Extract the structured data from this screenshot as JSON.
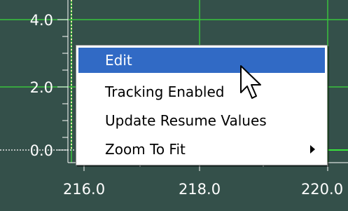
{
  "plot": {
    "x_ticks": [
      "216.0",
      "218.0",
      "220.0"
    ],
    "y_ticks": [
      "4.0",
      "2.0",
      "0.0"
    ],
    "colors": {
      "background": "#34504a",
      "grid": "#39c23c",
      "trace": "#39e33c",
      "axis": "#ffffff"
    }
  },
  "context_menu": {
    "items": [
      {
        "label": "Edit",
        "selected": true
      },
      {
        "label": "Tracking Enabled",
        "selected": false
      },
      {
        "label": "Update Resume Values",
        "selected": false
      },
      {
        "label": "Zoom To Fit",
        "selected": false,
        "has_submenu": true
      }
    ],
    "selected_color": "#316ac5"
  },
  "cursor": {
    "icon": "arrow-cursor-icon"
  }
}
